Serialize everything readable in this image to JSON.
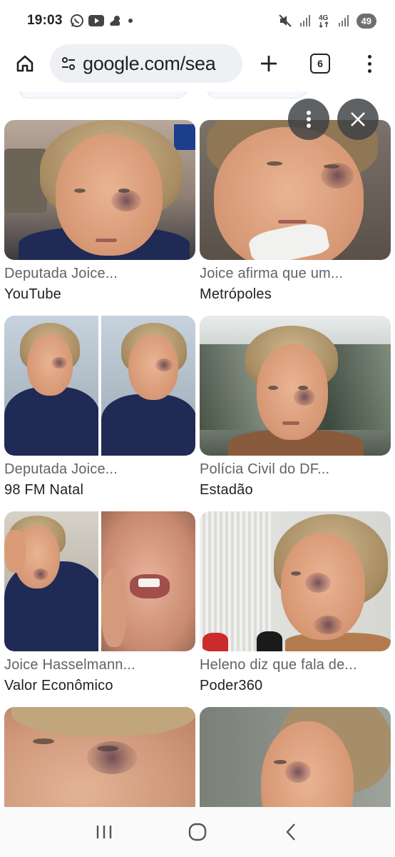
{
  "status_bar": {
    "time": "19:03",
    "left_icons": [
      "whatsapp-icon",
      "youtube-icon",
      "weather-icon",
      "dot-icon"
    ],
    "right_icons": [
      "mute-icon",
      "signal-icon",
      "4g-icon",
      "signal-icon"
    ],
    "battery": "49"
  },
  "toolbar": {
    "url": "google.com/sea",
    "tab_count": "6"
  },
  "results": [
    {
      "title": "Deputada Joice...",
      "source": "YouTube"
    },
    {
      "title": "Joice afirma que um...",
      "source": "Metrópoles"
    },
    {
      "title": "Deputada Joice...",
      "source": "98 FM Natal"
    },
    {
      "title": "Polícia Civil do DF...",
      "source": "Estadão"
    },
    {
      "title": "Joice Hasselmann...",
      "source": "Valor Econômico"
    },
    {
      "title": "Heleno diz que fala de...",
      "source": "Poder360"
    },
    {
      "title": "",
      "source": ""
    },
    {
      "title": "",
      "source": ""
    }
  ],
  "overlay": {
    "more_icon": "more-vert-icon",
    "close_icon": "close-icon"
  },
  "nav_bar": {
    "icons": [
      "recents-icon",
      "home-circle-icon",
      "back-icon"
    ]
  }
}
